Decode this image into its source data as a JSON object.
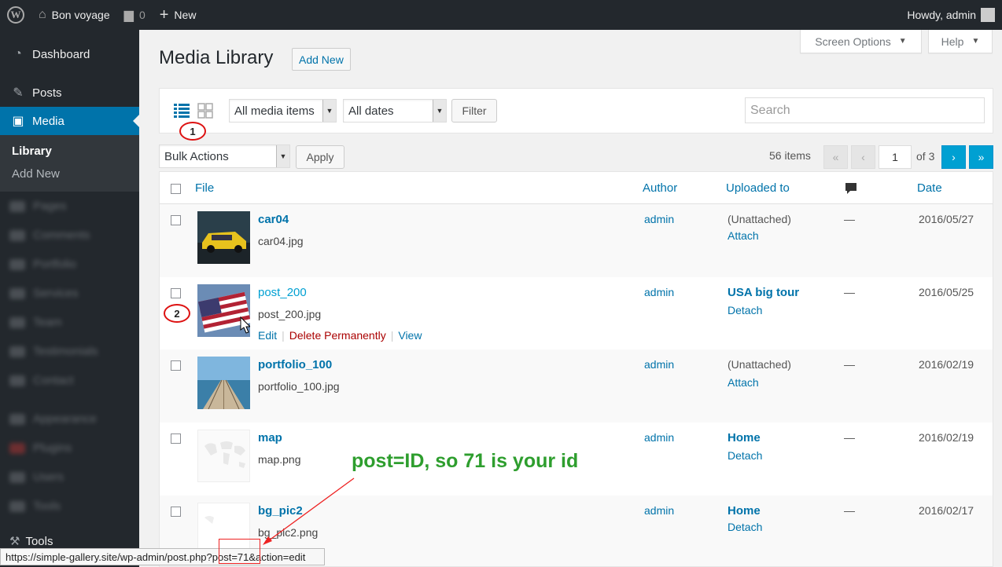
{
  "adminbar": {
    "site_name": "Bon voyage",
    "comments_count": "0",
    "new_label": "New",
    "howdy": "Howdy, admin"
  },
  "sidebar": {
    "dashboard": "Dashboard",
    "posts": "Posts",
    "media": "Media",
    "library": "Library",
    "add_new": "Add New",
    "blurred_items": [
      "Pages",
      "Comments",
      "Portfolio",
      "Services",
      "Team",
      "Testimonials",
      "Contact",
      "Appearance",
      "Plugins",
      "Users",
      "Tools"
    ],
    "tools": "Tools"
  },
  "screen_options": "Screen Options",
  "help": "Help",
  "page": {
    "title": "Media Library",
    "add_new": "Add New"
  },
  "filters": {
    "media_type": "All media items",
    "dates": "All dates",
    "filter_button": "Filter",
    "search_placeholder": "Search"
  },
  "bulk": {
    "actions": "Bulk Actions",
    "apply": "Apply"
  },
  "pagination": {
    "items": "56 items",
    "first": "«",
    "prev": "‹",
    "current": "1",
    "of": "of 3",
    "next": "›",
    "last": "»"
  },
  "table": {
    "headers": {
      "file": "File",
      "author": "Author",
      "uploaded_to": "Uploaded to",
      "date": "Date"
    },
    "rows": [
      {
        "title": "car04",
        "file": "car04.jpg",
        "author": "admin",
        "up1": "(Unattached)",
        "up2": "Attach",
        "comments": "—",
        "date": "2016/05/27"
      },
      {
        "title": "post_200",
        "file": "post_200.jpg",
        "author": "admin",
        "up1": "USA big tour",
        "up2": "Detach",
        "comments": "—",
        "date": "2016/05/25",
        "actions": [
          "Edit",
          "Delete Permanently",
          "View"
        ]
      },
      {
        "title": "portfolio_100",
        "file": "portfolio_100.jpg",
        "author": "admin",
        "up1": "(Unattached)",
        "up2": "Attach",
        "comments": "—",
        "date": "2016/02/19"
      },
      {
        "title": "map",
        "file": "map.png",
        "author": "admin",
        "up1": "Home",
        "up2": "Detach",
        "comments": "—",
        "date": "2016/02/19"
      },
      {
        "title": "bg_pic2",
        "file": "bg_pic2.png",
        "author": "admin",
        "up1": "Home",
        "up2": "Detach",
        "comments": "—",
        "date": "2016/02/17"
      }
    ]
  },
  "annotations": {
    "circle1": "1",
    "circle2": "2",
    "note": "post=ID, so 71 is your id"
  },
  "statusbar": {
    "url": "https://simple-gallery.site/wp-admin/post.php?post=71&action=edit"
  },
  "colors": {
    "accent": "#0073aa",
    "adminbar": "#23282d",
    "note_green": "#2e9e2e",
    "annotation_red": "#dd1111"
  }
}
